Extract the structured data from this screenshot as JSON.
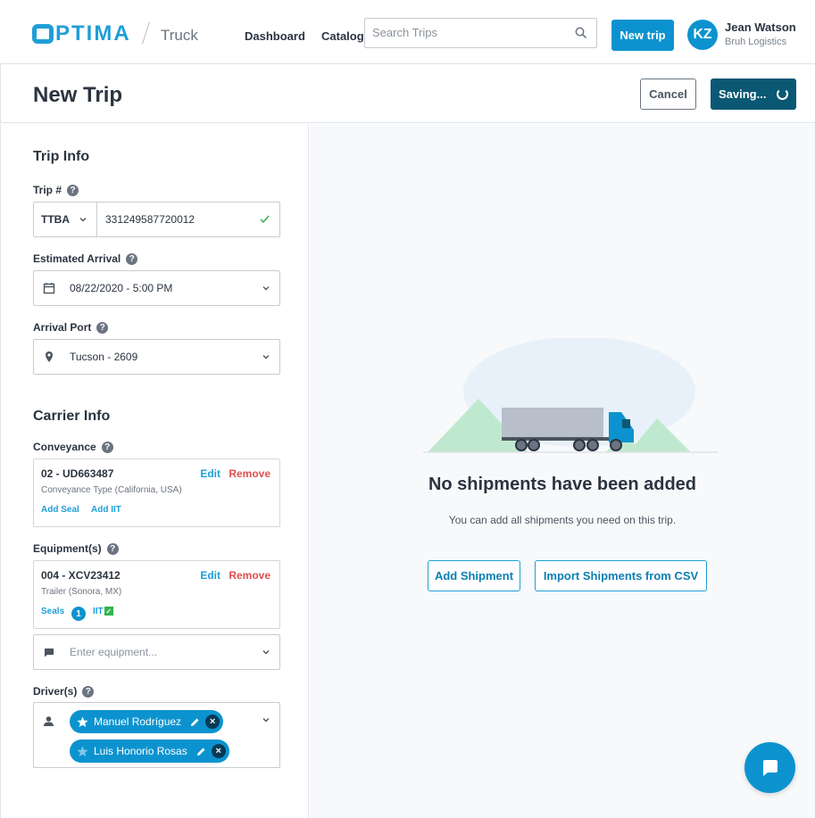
{
  "brand": {
    "logo_text": "PTIMA",
    "product": "Truck"
  },
  "nav": {
    "dashboard": "Dashboard",
    "catalogs": "Catalogs"
  },
  "search": {
    "placeholder": "Search Trips",
    "value": ""
  },
  "header_actions": {
    "new_trip": "New trip"
  },
  "user": {
    "initials": "KZ",
    "name": "Jean Watson",
    "company": "Bruh Logistics"
  },
  "page": {
    "title": "New Trip",
    "cancel": "Cancel",
    "saving": "Saving..."
  },
  "trip_info": {
    "title": "Trip Info",
    "trip_label": "Trip #",
    "trip_prefix": "TTBA",
    "trip_number": "331249587720012",
    "arrival_label": "Estimated Arrival",
    "arrival_value": "08/22/2020 - 5:00 PM",
    "port_label": "Arrival Port",
    "port_value": "Tucson - 2609"
  },
  "carrier_info": {
    "title": "Carrier Info",
    "conveyance_label": "Conveyance",
    "conveyance": {
      "title": "02 - UD663487",
      "subtitle": "Conveyance Type (California, USA)",
      "edit": "Edit",
      "remove": "Remove",
      "add_seal": "Add Seal",
      "add_iit": "Add IIT"
    },
    "equipment_label": "Equipment(s)",
    "equipment": {
      "title": "004 - XCV23412",
      "subtitle": "Trailer (Sonora, MX)",
      "edit": "Edit",
      "remove": "Remove",
      "seals": "Seals",
      "seal_count": "1",
      "iit": "IIT"
    },
    "equipment_placeholder": "Enter equipment...",
    "drivers_label": "Driver(s)",
    "drivers": [
      {
        "name": "Manuel Rodríguez"
      },
      {
        "name": "Luis Honorio Rosas"
      }
    ]
  },
  "empty_state": {
    "title": "No shipments have been added",
    "description": "You can add all shipments you need on this trip.",
    "add_shipment": "Add Shipment",
    "import_csv": "Import Shipments from CSV"
  },
  "colors": {
    "accent": "#0c93cf",
    "dark_accent": "#0b5874",
    "danger": "#e04f4f",
    "success": "#2fb34a"
  }
}
